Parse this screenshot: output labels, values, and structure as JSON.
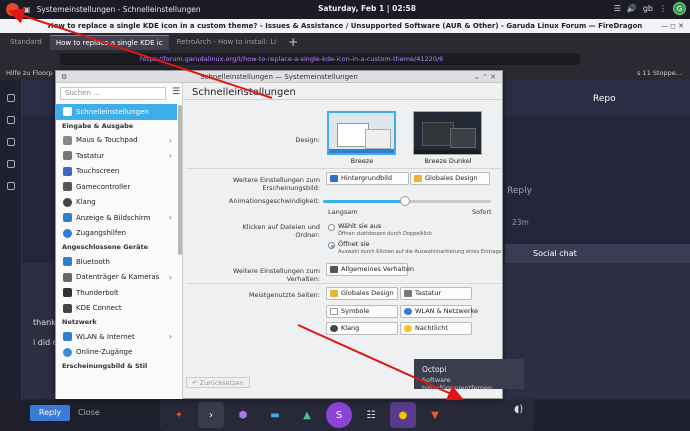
{
  "topbar": {
    "title": "Systemeinstellungen - Schnelleinstellungen",
    "clock": "Saturday, Feb 1 | 02:58",
    "locale": "gb",
    "user_initial": "G"
  },
  "firefox": {
    "window_title": "How to replace a single KDE icon in a custom theme? - Issues & Assistance / Unsupported Software (AUR & Other) - Garuda Linux Forum — FireDragon",
    "tabs": [
      "Standard",
      "How to replace a single KDE ic",
      "RetroArch - How to install: Li"
    ],
    "url": "https://forum.garudalinux.org/t/how-to-replace-a-single-kde-icon-in-a-custom-theme/41220/6",
    "bookmarks_left": "Hilfe zu Floorp",
    "bookmarks_right": "s 11 Stoppe..."
  },
  "forum": {
    "repo": "Repo",
    "reply": "Reply",
    "time": "23m",
    "social": "Social chat",
    "text1": "thanks",
    "text2": "i did c",
    "reply_button": "Reply",
    "close": "Close"
  },
  "window": {
    "title": "Schnelleinstellungen — Systemeinstellungen",
    "search_placeholder": "Suchen ...",
    "page_title": "Schnelleinstellungen",
    "sidebar": {
      "active": "Schnelleinstellungen",
      "group1": "Eingabe & Ausgabe",
      "items1": [
        "Maus & Touchpad",
        "Tastatur",
        "Touchscreen",
        "Gamecontroller",
        "Klang",
        "Anzeige & Bildschirm",
        "Zugangshilfen"
      ],
      "group2": "Angeschlossene Geräte",
      "items2": [
        "Bluetooth",
        "Datenträger & Kameras",
        "Thunderbolt",
        "KDE Connect"
      ],
      "group3": "Netzwerk",
      "items3": [
        "WLAN & Internet",
        "Online-Zugänge"
      ],
      "group4": "Erscheinungsbild & Stil"
    },
    "design_label": "Design:",
    "theme1": "Breeze",
    "theme2": "Breeze Dunkel",
    "more_look_label": "Weitere Einstellungen zum Erscheinungsbild:",
    "wallpaper_btn": "Hintergrundbild",
    "global_btn": "Globales Design",
    "anim_label": "Animationsgeschwindigkeit:",
    "anim_slow": "Langsam",
    "anim_fast": "Sofort",
    "anim_value": 0.49,
    "click_label": "Klicken auf Dateien und Ordner:",
    "radio1": "Wählt sie aus",
    "radio1_sub": "Öffnen stattdessen durch Doppelklick",
    "radio2": "Öffnet sie",
    "radio2_sub": "Auswahl durch Klicken auf die Auswahlmarkierung eines Eintrags",
    "behavior_label": "Weitere Einstellungen zum Verhalten:",
    "behavior_btn": "Allgemeines Verhalten",
    "most_used_label": "Meistgenutzte Seiten:",
    "most_used": [
      "Globales Design",
      "Tastatur",
      "Symbole",
      "WLAN & Netzwerke",
      "Klang",
      "Nachtlicht"
    ],
    "reset": "Zurücksetzen"
  },
  "tooltip": {
    "title": "Octopi",
    "subtitle": "Software hinzufügen/entfernen"
  },
  "colors": {
    "accent": "#3daee9",
    "arrow": "#e01515"
  }
}
